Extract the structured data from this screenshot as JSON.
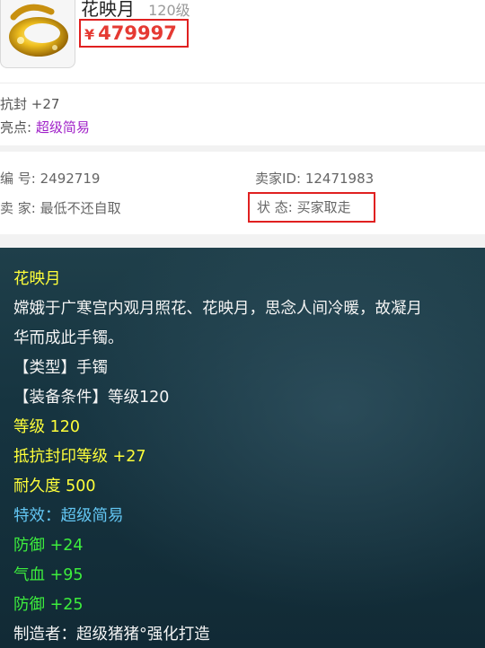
{
  "item": {
    "name": "花映月",
    "level": "120级",
    "price_symbol": "¥",
    "price": "479997"
  },
  "attributes": {
    "seal_resist": "抗封 +27",
    "highlight_label": "亮点:",
    "highlight_value": "超级简易"
  },
  "info": {
    "id_label": "编 号:",
    "id_value": "2492719",
    "seller_id_label": "卖家ID:",
    "seller_id_value": "12471983",
    "seller_label": "卖 家:",
    "seller_value": "最低不还自取",
    "status_label": "状 态:",
    "status_value": "买家取走"
  },
  "tooltip": {
    "title": "花映月",
    "desc_line1": "嫦娥于广寒宫内观月照花、花映月，思念人间冷暖，故凝月",
    "desc_line2": "华而成此手镯。",
    "type": "【类型】手镯",
    "requirement": "【装备条件】等级120",
    "level": "等级 120",
    "seal_resist": "抵抗封印等级 +27",
    "durability": "耐久度 500",
    "special_effect": "特效：超级简易",
    "defense1": "防御 +24",
    "hp": "气血 +95",
    "defense2": "防御 +25",
    "maker": "制造者：超级猪猪°强化打造"
  },
  "colors": {
    "price": "#e53a33",
    "highlight": "#a020c8",
    "box_border": "#e02020",
    "tip_yellow": "#ffff3a",
    "tip_blue": "#63c6f3",
    "tip_green": "#3dee3d"
  },
  "icons": {
    "item_image": "gold-bracelet-icon"
  }
}
